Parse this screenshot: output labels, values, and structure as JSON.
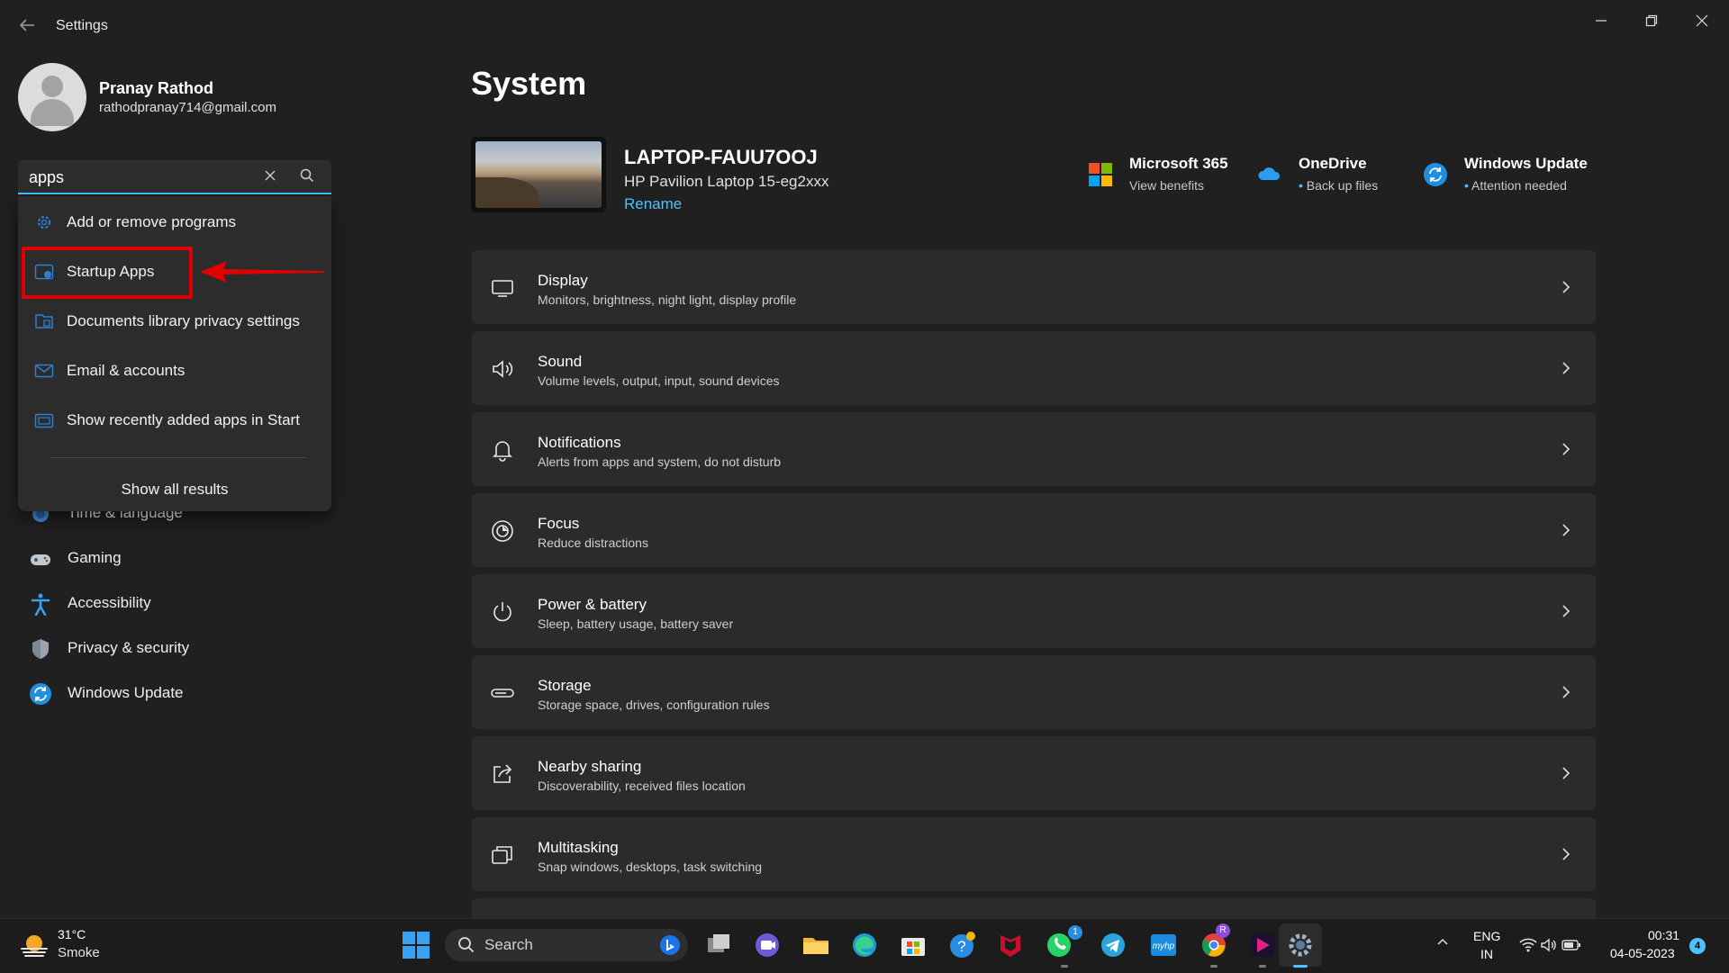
{
  "window": {
    "title": "Settings",
    "back_icon": "back-arrow-icon"
  },
  "profile": {
    "name": "Pranay Rathod",
    "email": "rathodpranay714@gmail.com"
  },
  "search": {
    "value": "apps",
    "results": [
      {
        "label": "Add or remove programs",
        "icon": "gear-icon"
      },
      {
        "label": "Startup Apps",
        "icon": "startup-apps-icon"
      },
      {
        "label": "Documents library privacy settings",
        "icon": "documents-icon"
      },
      {
        "label": "Email & accounts",
        "icon": "mail-icon"
      },
      {
        "label": "Show recently added apps in Start",
        "icon": "start-menu-icon"
      }
    ],
    "show_all": "Show all results"
  },
  "annotation": {
    "color": "#e00000"
  },
  "sidebar": {
    "items": [
      {
        "label": "Time & language",
        "icon": "clock-globe-icon"
      },
      {
        "label": "Gaming",
        "icon": "gamepad-icon"
      },
      {
        "label": "Accessibility",
        "icon": "accessibility-icon"
      },
      {
        "label": "Privacy & security",
        "icon": "shield-icon"
      },
      {
        "label": "Windows Update",
        "icon": "sync-icon"
      }
    ]
  },
  "main": {
    "title": "System",
    "device": {
      "name": "LAPTOP-FAUU7OOJ",
      "model": "HP Pavilion Laptop 15-eg2xxx",
      "rename": "Rename"
    },
    "top_cards": [
      {
        "title": "Microsoft 365",
        "subtitle": "View benefits",
        "icon": "microsoft-logo-icon"
      },
      {
        "title": "OneDrive",
        "subtitle": "Back up files",
        "icon": "cloud-icon"
      },
      {
        "title": "Windows Update",
        "subtitle": "Attention needed",
        "icon": "sync-icon"
      }
    ],
    "settings": [
      {
        "title": "Display",
        "subtitle": "Monitors, brightness, night light, display profile",
        "icon": "display-icon"
      },
      {
        "title": "Sound",
        "subtitle": "Volume levels, output, input, sound devices",
        "icon": "speaker-icon"
      },
      {
        "title": "Notifications",
        "subtitle": "Alerts from apps and system, do not disturb",
        "icon": "bell-icon"
      },
      {
        "title": "Focus",
        "subtitle": "Reduce distractions",
        "icon": "focus-icon"
      },
      {
        "title": "Power & battery",
        "subtitle": "Sleep, battery usage, battery saver",
        "icon": "power-icon"
      },
      {
        "title": "Storage",
        "subtitle": "Storage space, drives, configuration rules",
        "icon": "storage-icon"
      },
      {
        "title": "Nearby sharing",
        "subtitle": "Discoverability, received files location",
        "icon": "share-icon"
      },
      {
        "title": "Multitasking",
        "subtitle": "Snap windows, desktops, task switching",
        "icon": "multitasking-icon"
      }
    ]
  },
  "taskbar": {
    "weather": {
      "temp": "31°C",
      "condition": "Smoke"
    },
    "search_label": "Search",
    "apps": [
      "bing-icon",
      "task-view-icon",
      "teams-chat-icon",
      "file-explorer-icon",
      "edge-icon",
      "store-icon",
      "help-icon",
      "mcafee-icon",
      "whatsapp-icon",
      "telegram-icon",
      "myhp-icon",
      "chrome-icon",
      "media-app-icon",
      "settings-icon"
    ],
    "whatsapp_badge": "1",
    "chrome_badge": "R",
    "lang_top": "ENG",
    "lang_bottom": "IN",
    "time": "00:31",
    "date": "04-05-2023",
    "notification_count": "4"
  },
  "colors": {
    "accent": "#4cc2ff",
    "background": "#202020",
    "card": "#2b2b2b",
    "annotation": "#e00000"
  }
}
